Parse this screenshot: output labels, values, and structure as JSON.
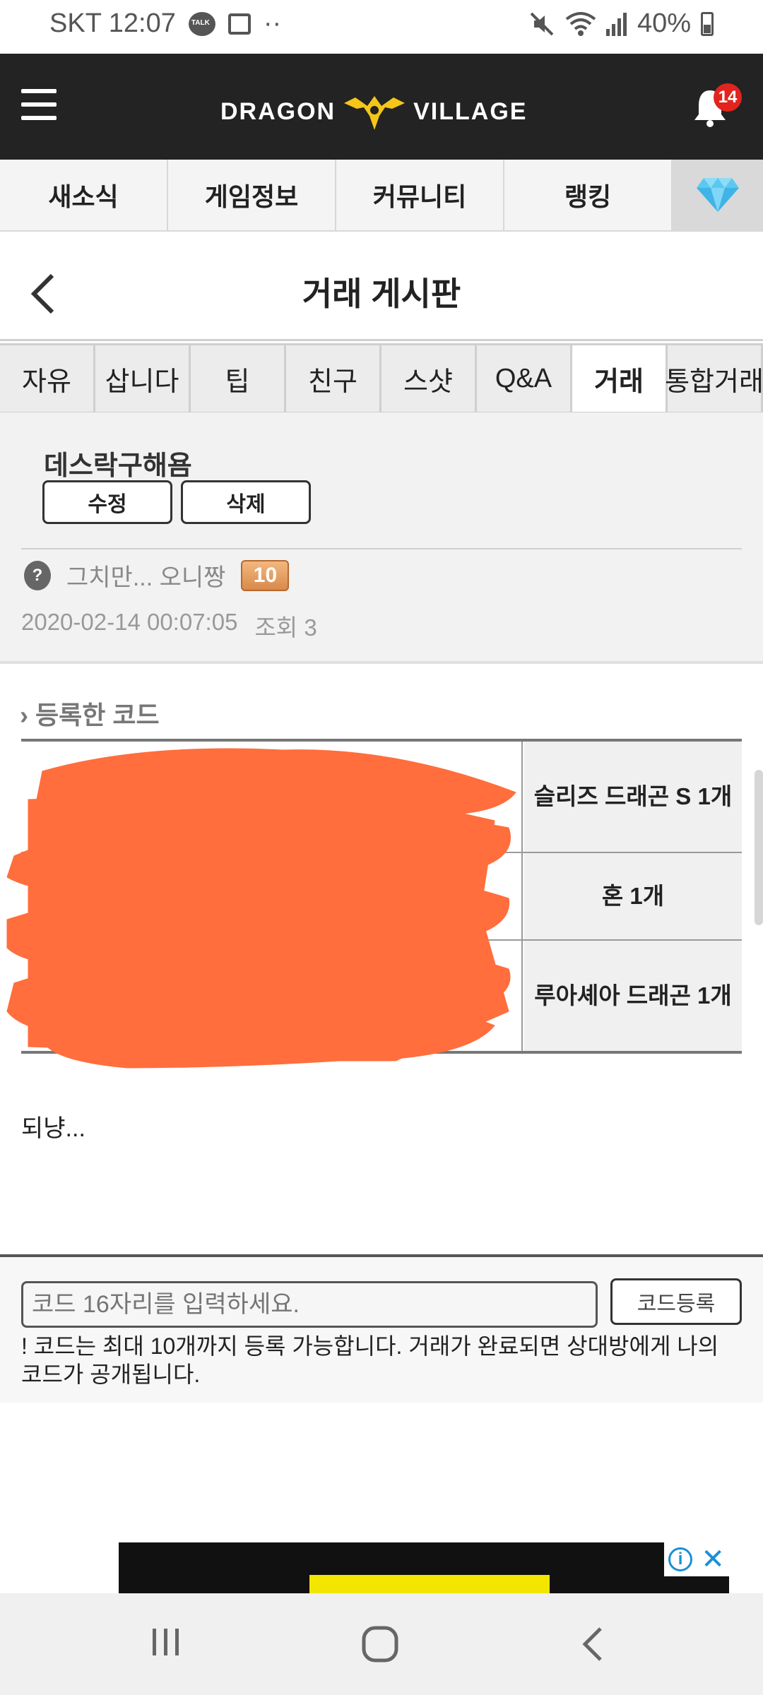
{
  "status_bar": {
    "carrier_time": "SKT 12:07",
    "talk_badge": "TALK",
    "dots": "··",
    "battery": "40%"
  },
  "header": {
    "logo_left": "DRAGON",
    "logo_right": "VILLAGE",
    "notification_count": "14"
  },
  "main_nav": {
    "items": [
      "새소식",
      "게임정보",
      "커뮤니티",
      "랭킹"
    ]
  },
  "page": {
    "title": "거래 게시판"
  },
  "board_tabs": {
    "items": [
      "자유",
      "삽니다",
      "팁",
      "친구",
      "스샷",
      "Q&A",
      "거래",
      "통합거래"
    ],
    "active": "거래"
  },
  "post": {
    "title": "데스락구해욤",
    "edit_label": "수정",
    "delete_label": "삭제",
    "author": "그치만... 오니짱",
    "level": "10",
    "date": "2020-02-14 00:07:05",
    "views": "조회 3",
    "body": "되냥..."
  },
  "codes": {
    "label": "등록한 코드",
    "rows": [
      {
        "item": "슬리즈 드래곤 S 1개"
      },
      {
        "item": "혼 1개"
      },
      {
        "item": "루아셰아 드래곤 1개"
      }
    ]
  },
  "code_entry": {
    "placeholder": "코드 16자리를 입력하세요.",
    "button": "코드등록",
    "note": "! 코드는 최대 10개까지 등록 가능합니다. 거래가 완료되면 상대방에게 나의 코드가 공개됩니다."
  },
  "colors": {
    "header_bg": "#232323",
    "logo_accent": "#f5c518",
    "badge": "#e2241e",
    "scribble": "#ff6e3c",
    "ad_accent": "#1a8fd6"
  }
}
